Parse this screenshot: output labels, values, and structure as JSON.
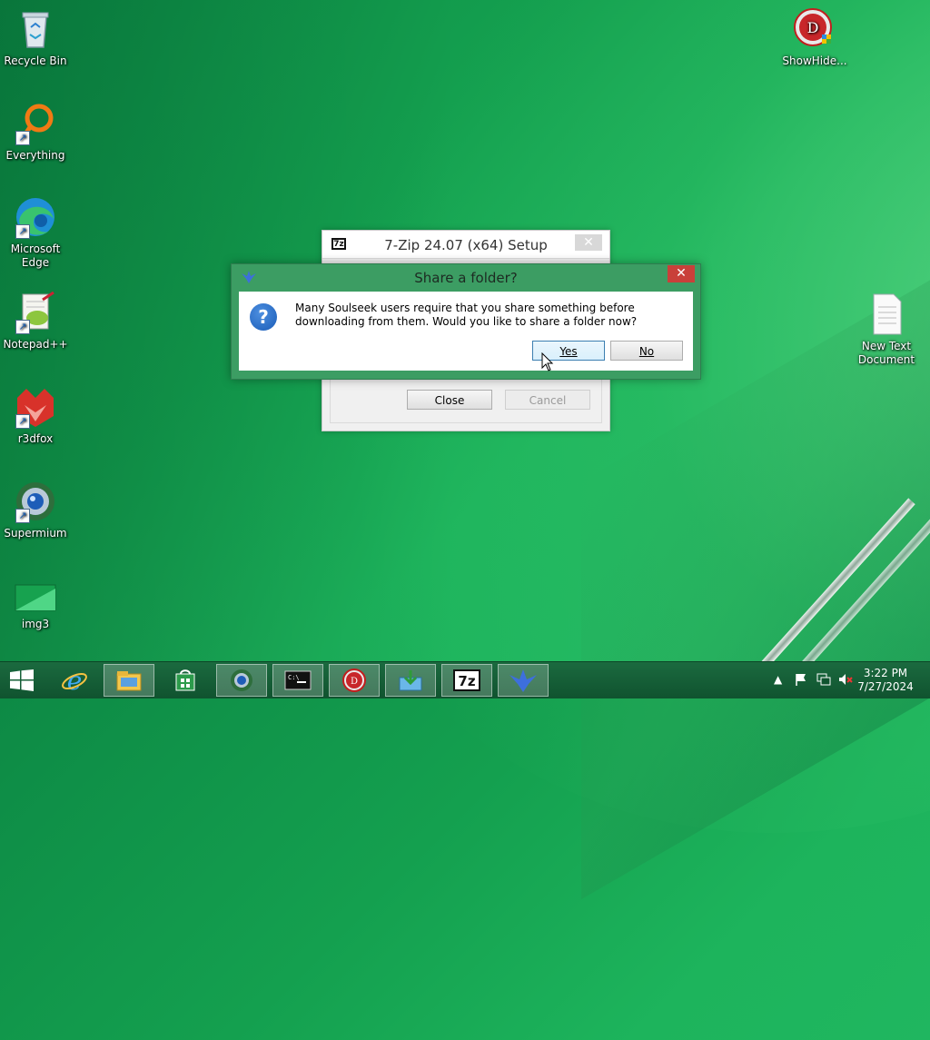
{
  "desktop_icons": [
    {
      "label": "Recycle Bin",
      "icon": "recycle-bin-icon"
    },
    {
      "label": "Everything",
      "icon": "everything-icon"
    },
    {
      "label": "Microsoft Edge",
      "icon": "edge-icon"
    },
    {
      "label": "Notepad++",
      "icon": "notepad-plus-plus-icon"
    },
    {
      "label": "r3dfox",
      "icon": "r3dfox-icon"
    },
    {
      "label": "Supermium",
      "icon": "supermium-icon"
    },
    {
      "label": "img3",
      "icon": "image-file-icon"
    },
    {
      "label": "ShowHide...",
      "icon": "showhide-icon"
    },
    {
      "label": "New Text Document",
      "icon": "text-document-icon"
    }
  ],
  "zip_window": {
    "title": "7-Zip 24.07 (x64) Setup",
    "logo_text": "7z",
    "close_label": "Close",
    "cancel_label": "Cancel"
  },
  "share_dialog": {
    "title": "Share a folder?",
    "message": "Many Soulseek users require that you share something before downloading from them. Would you like to share a folder now?",
    "yes_label": "Yes",
    "no_label": "No"
  },
  "taskbar": {
    "time": "3:22 PM",
    "date": "7/27/2024",
    "apps": [
      {
        "icon": "internet-explorer-icon"
      },
      {
        "icon": "file-explorer-icon"
      },
      {
        "icon": "store-icon"
      },
      {
        "icon": "supermium-icon"
      },
      {
        "icon": "command-prompt-icon"
      },
      {
        "icon": "showhide-icon"
      },
      {
        "icon": "download-icon"
      },
      {
        "icon": "7zip-icon"
      },
      {
        "icon": "soulseek-icon"
      }
    ]
  },
  "colors": {
    "accent": "#3c9d63",
    "close_red": "#c9403a",
    "taskbar": "#10532f"
  }
}
